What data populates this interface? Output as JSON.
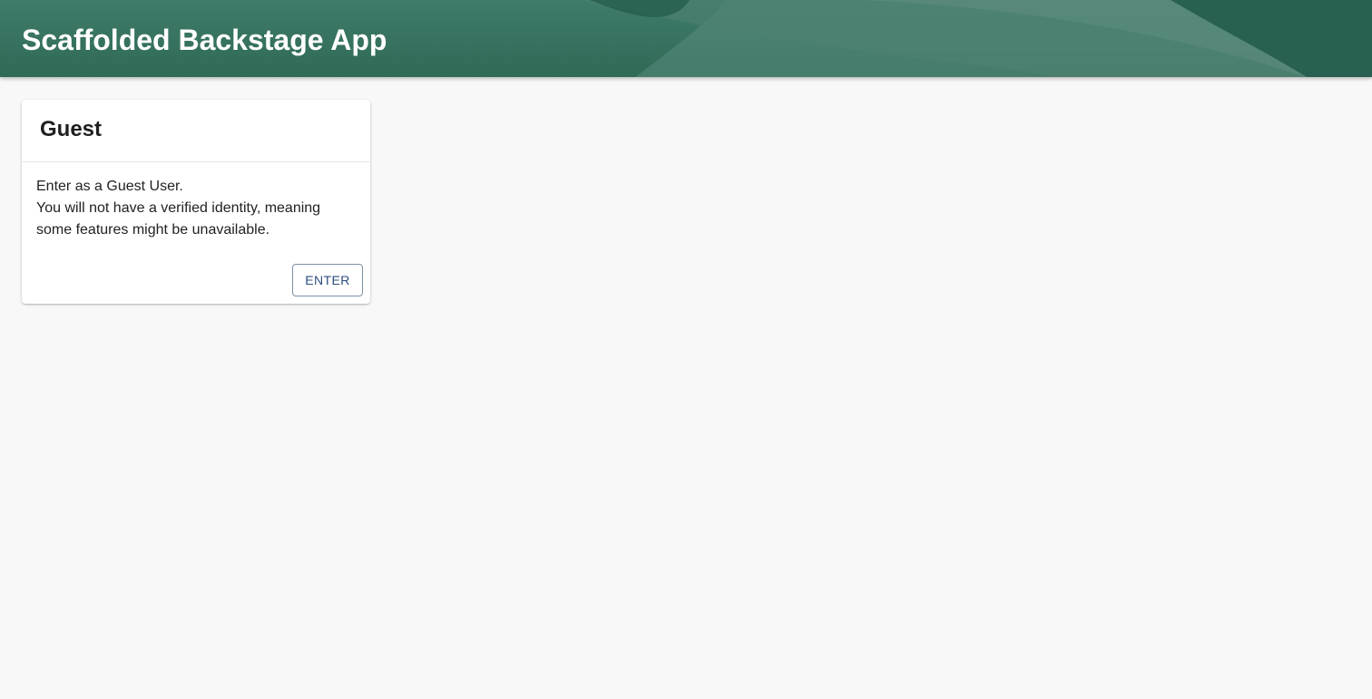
{
  "header": {
    "title": "Scaffolded Backstage App",
    "colors": {
      "base": "#35735f",
      "dark": "#245c4d",
      "light": "#5a8a7c"
    }
  },
  "guest_card": {
    "title": "Guest",
    "description_lines": [
      "Enter as a Guest User.",
      "You will not have a verified identity, meaning",
      "some features might be unavailable."
    ],
    "enter_label": "ENTER"
  },
  "colors": {
    "page_background": "#f8f8f8",
    "button_text": "#2e4d80"
  }
}
